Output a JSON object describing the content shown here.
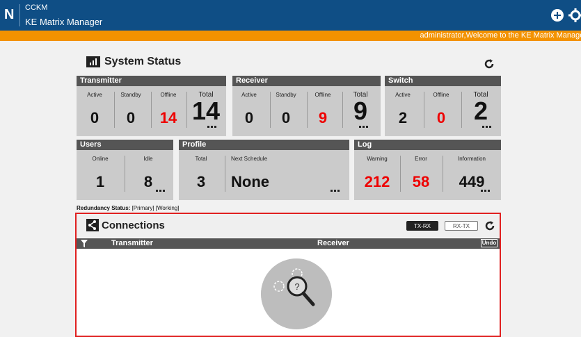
{
  "header": {
    "logo_letter": "N",
    "app_name": "CCKM",
    "app_subtitle": "KE Matrix Manager",
    "welcome": "administrator,Welcome to the KE Matrix Manager"
  },
  "colors": {
    "header_bg": "#0f4e85",
    "accent_bar": "#f39200",
    "alert_red": "#e00000",
    "card_head": "#555555",
    "connections_border": "#e02020"
  },
  "system_status": {
    "title": "System Status",
    "transmitter": {
      "title": "Transmitter",
      "active_label": "Active",
      "active": "0",
      "standby_label": "Standby",
      "standby": "0",
      "offline_label": "Offline",
      "offline": "14",
      "total_label": "Total",
      "total": "14"
    },
    "receiver": {
      "title": "Receiver",
      "active_label": "Active",
      "active": "0",
      "standby_label": "Standby",
      "standby": "0",
      "offline_label": "Offline",
      "offline": "9",
      "total_label": "Total",
      "total": "9"
    },
    "switch": {
      "title": "Switch",
      "active_label": "Active",
      "active": "2",
      "offline_label": "Offline",
      "offline": "0",
      "total_label": "Total",
      "total": "2"
    },
    "users": {
      "title": "Users",
      "online_label": "Online",
      "online": "1",
      "idle_label": "Idle",
      "idle": "8"
    },
    "profile": {
      "title": "Profile",
      "total_label": "Total",
      "total": "3",
      "next_label": "Next Schedule",
      "next": "None"
    },
    "log": {
      "title": "Log",
      "warning_label": "Warning",
      "warning": "212",
      "error_label": "Error",
      "error": "58",
      "info_label": "Information",
      "info": "449"
    }
  },
  "redundancy": {
    "label": "Redundancy Status:",
    "value": "[Primary] [Working]"
  },
  "connections": {
    "title": "Connections",
    "btn_txrx": "TX-RX",
    "btn_rxtx": "RX-TX",
    "col_transmitter": "Transmitter",
    "col_receiver": "Receiver",
    "undo": "Undo"
  },
  "icons": [
    "add-icon",
    "gear-icon",
    "bar-chart-icon",
    "refresh-icon",
    "share-icon",
    "filter-icon",
    "search-question-icon"
  ]
}
